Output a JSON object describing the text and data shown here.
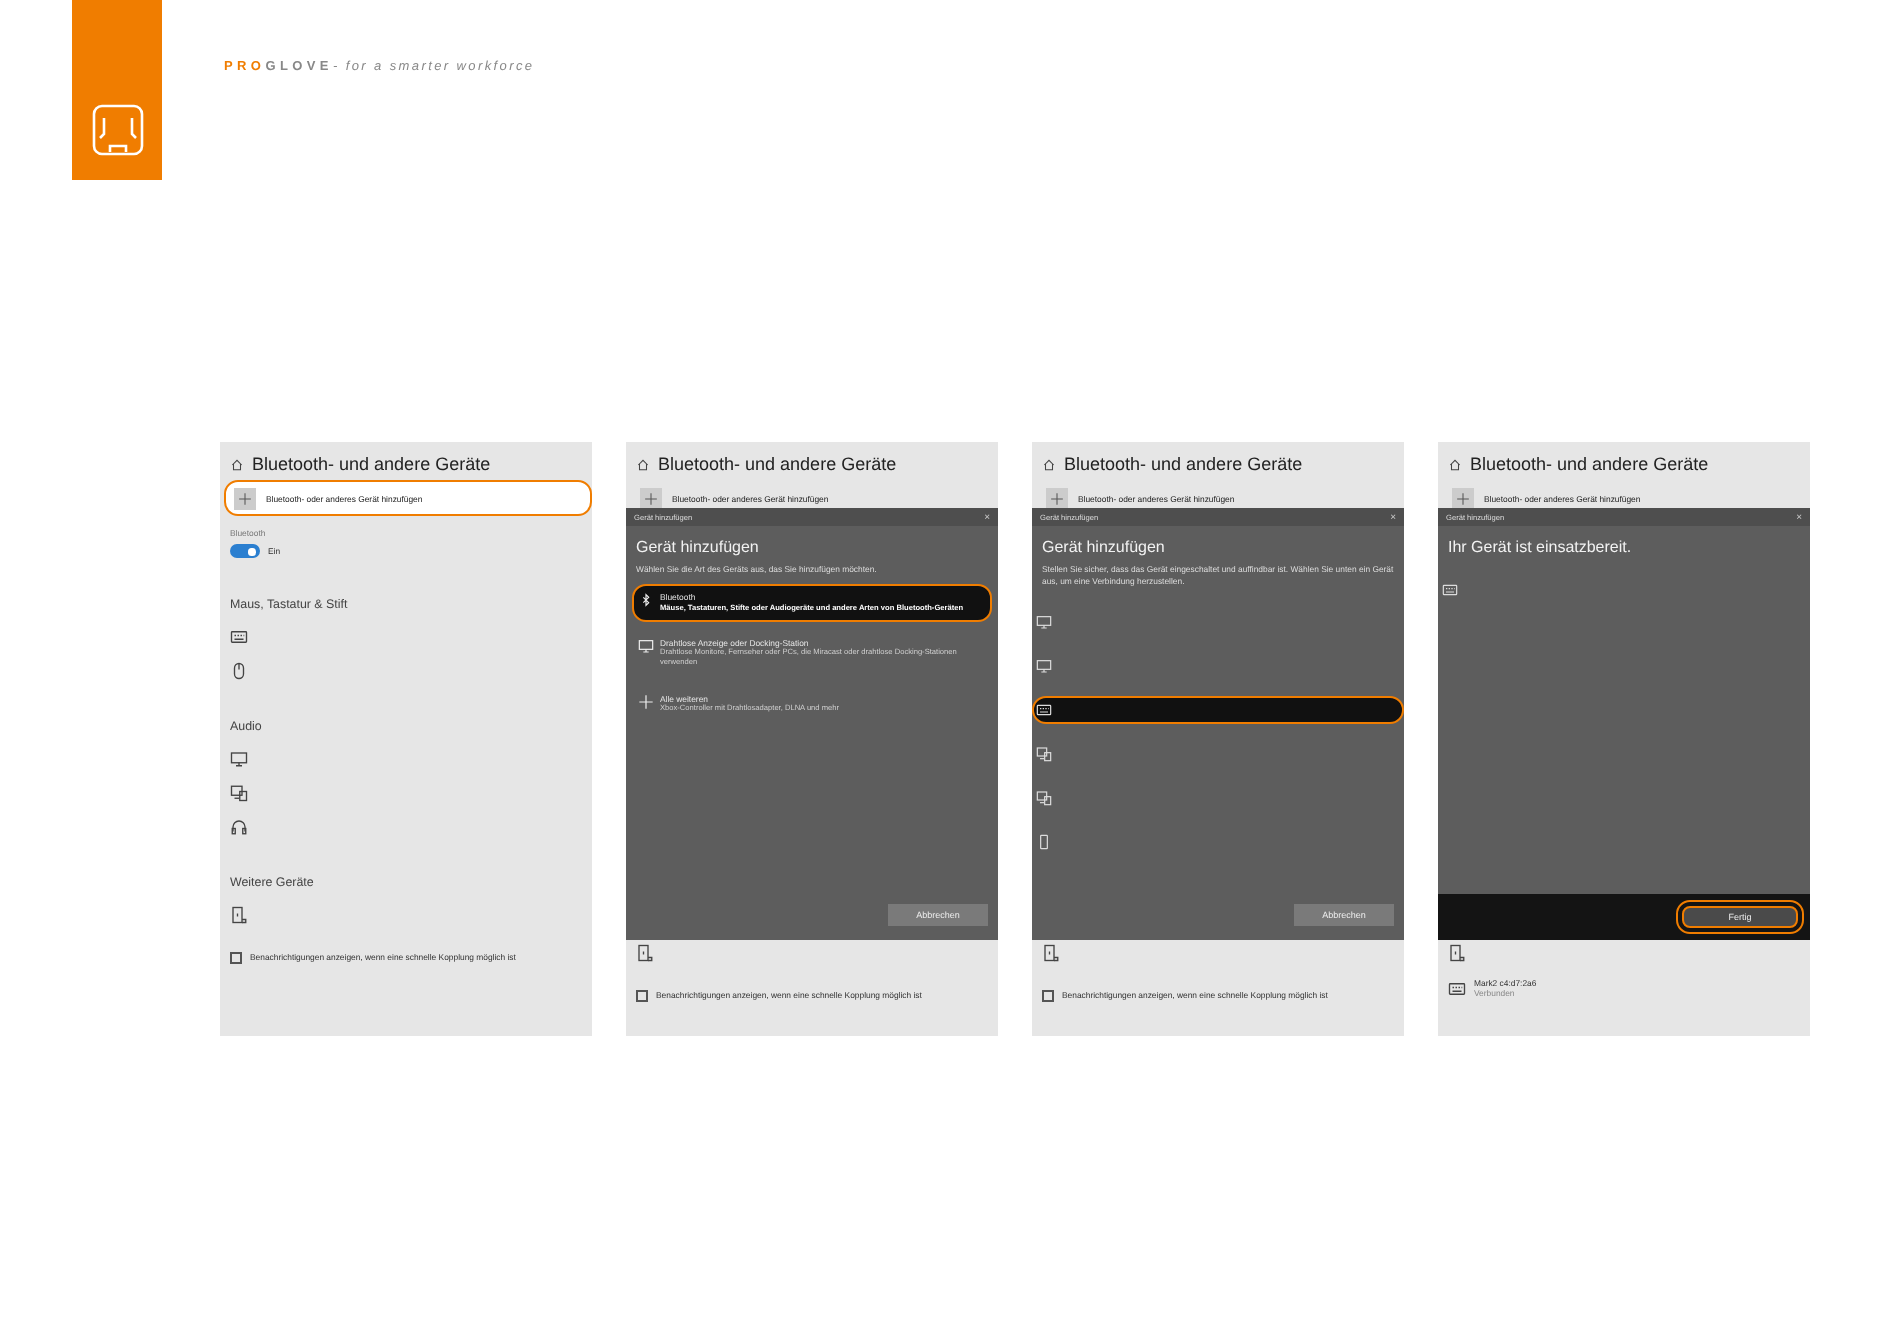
{
  "brand": {
    "accent": "PRO",
    "name_rest": "GLOVE",
    "tagline": " - for a smarter workforce"
  },
  "screens": [
    {
      "title": "Bluetooth- und andere Geräte",
      "add": {
        "label": "Bluetooth- oder anderes Gerät hinzufügen",
        "highlighted": true
      },
      "rows": [
        {
          "kind": "label",
          "text": "Bluetooth"
        },
        {
          "kind": "toggle",
          "on": true,
          "text": "Ein"
        },
        {
          "kind": "heading",
          "text": "Maus, Tastatur & Stift"
        },
        {
          "kind": "keyboard"
        },
        {
          "kind": "mouse"
        },
        {
          "kind": "heading",
          "text": "Audio"
        },
        {
          "kind": "display"
        },
        {
          "kind": "devices"
        },
        {
          "kind": "headphones"
        },
        {
          "kind": "heading",
          "text": "Weitere Geräte"
        },
        {
          "kind": "tablet"
        },
        {
          "kind": "checkbox",
          "checked": false,
          "text": "Benachrichtigungen anzeigen, wenn eine schnelle Kopplung möglich ist"
        }
      ]
    },
    {
      "title": "Bluetooth- und andere Geräte",
      "add": {
        "label": "Bluetooth- oder anderes Gerät hinzufügen",
        "highlighted": false
      },
      "dialog": {
        "caption": "Gerät hinzufügen",
        "close": "×",
        "heading": "Gerät hinzufügen",
        "text": "Wählen Sie die Art des Geräts aus, das Sie hinzufügen möchten.",
        "options": [
          {
            "kind": "bluetooth",
            "title": "Bluetooth",
            "desc": "Mäuse, Tastaturen, Stifte oder Audiogeräte und andere Arten von Bluetooth-Geräten",
            "selected": true,
            "highlighted": true
          },
          {
            "kind": "display",
            "title": "Drahtlose Anzeige oder Docking-Station",
            "desc": "Drahtlose Monitore, Fernseher oder PCs, die Miracast oder drahtlose Docking-Stationen verwenden",
            "selected": false,
            "highlighted": false
          },
          {
            "kind": "plus",
            "title": "Alle weiteren",
            "desc": "Xbox-Controller mit Drahtlosadapter, DLNA und mehr",
            "selected": false,
            "highlighted": false
          }
        ],
        "button": {
          "label": "Abbrechen",
          "highlighted": false
        },
        "dark_footer": false
      },
      "rows": [
        {
          "kind": "tablet"
        },
        {
          "kind": "checkbox",
          "checked": false,
          "text": "Benachrichtigungen anzeigen, wenn eine schnelle Kopplung möglich ist"
        }
      ]
    },
    {
      "title": "Bluetooth- und andere Geräte",
      "add": {
        "label": "Bluetooth- oder anderes Gerät hinzufügen",
        "highlighted": false
      },
      "dialog": {
        "caption": "Gerät hinzufügen",
        "close": "×",
        "heading": "Gerät hinzufügen",
        "text": "Stellen Sie sicher, dass das Gerät eingeschaltet und auffindbar ist. Wählen Sie unten ein Gerät aus, um eine Verbindung herzustellen.",
        "devices": [
          {
            "kind": "display",
            "selected": false,
            "highlighted": false
          },
          {
            "kind": "display",
            "selected": false,
            "highlighted": false
          },
          {
            "kind": "keyboard",
            "selected": true,
            "highlighted": true
          },
          {
            "kind": "devices",
            "selected": false,
            "highlighted": false
          },
          {
            "kind": "devices",
            "selected": false,
            "highlighted": false
          },
          {
            "kind": "phone",
            "selected": false,
            "highlighted": false
          }
        ],
        "button": {
          "label": "Abbrechen",
          "highlighted": false
        },
        "dark_footer": false
      },
      "rows": [
        {
          "kind": "tablet"
        },
        {
          "kind": "checkbox",
          "checked": false,
          "text": "Benachrichtigungen anzeigen, wenn eine schnelle Kopplung möglich ist"
        }
      ]
    },
    {
      "title": "Bluetooth- und andere Geräte",
      "add": {
        "label": "Bluetooth- oder anderes Gerät hinzufügen",
        "highlighted": false
      },
      "dialog": {
        "caption": "Gerät hinzufügen",
        "close": "×",
        "heading": "Ihr Gerät ist einsatzbereit.",
        "devices": [
          {
            "kind": "keyboard",
            "selected": false,
            "highlighted": false
          }
        ],
        "button": {
          "label": "Fertig",
          "highlighted": true
        },
        "dark_footer": true
      },
      "rows": [
        {
          "kind": "tablet"
        },
        {
          "kind": "keyboard",
          "name": "Mark2 c4:d7:2a6",
          "status": "Verbunden"
        }
      ]
    }
  ]
}
